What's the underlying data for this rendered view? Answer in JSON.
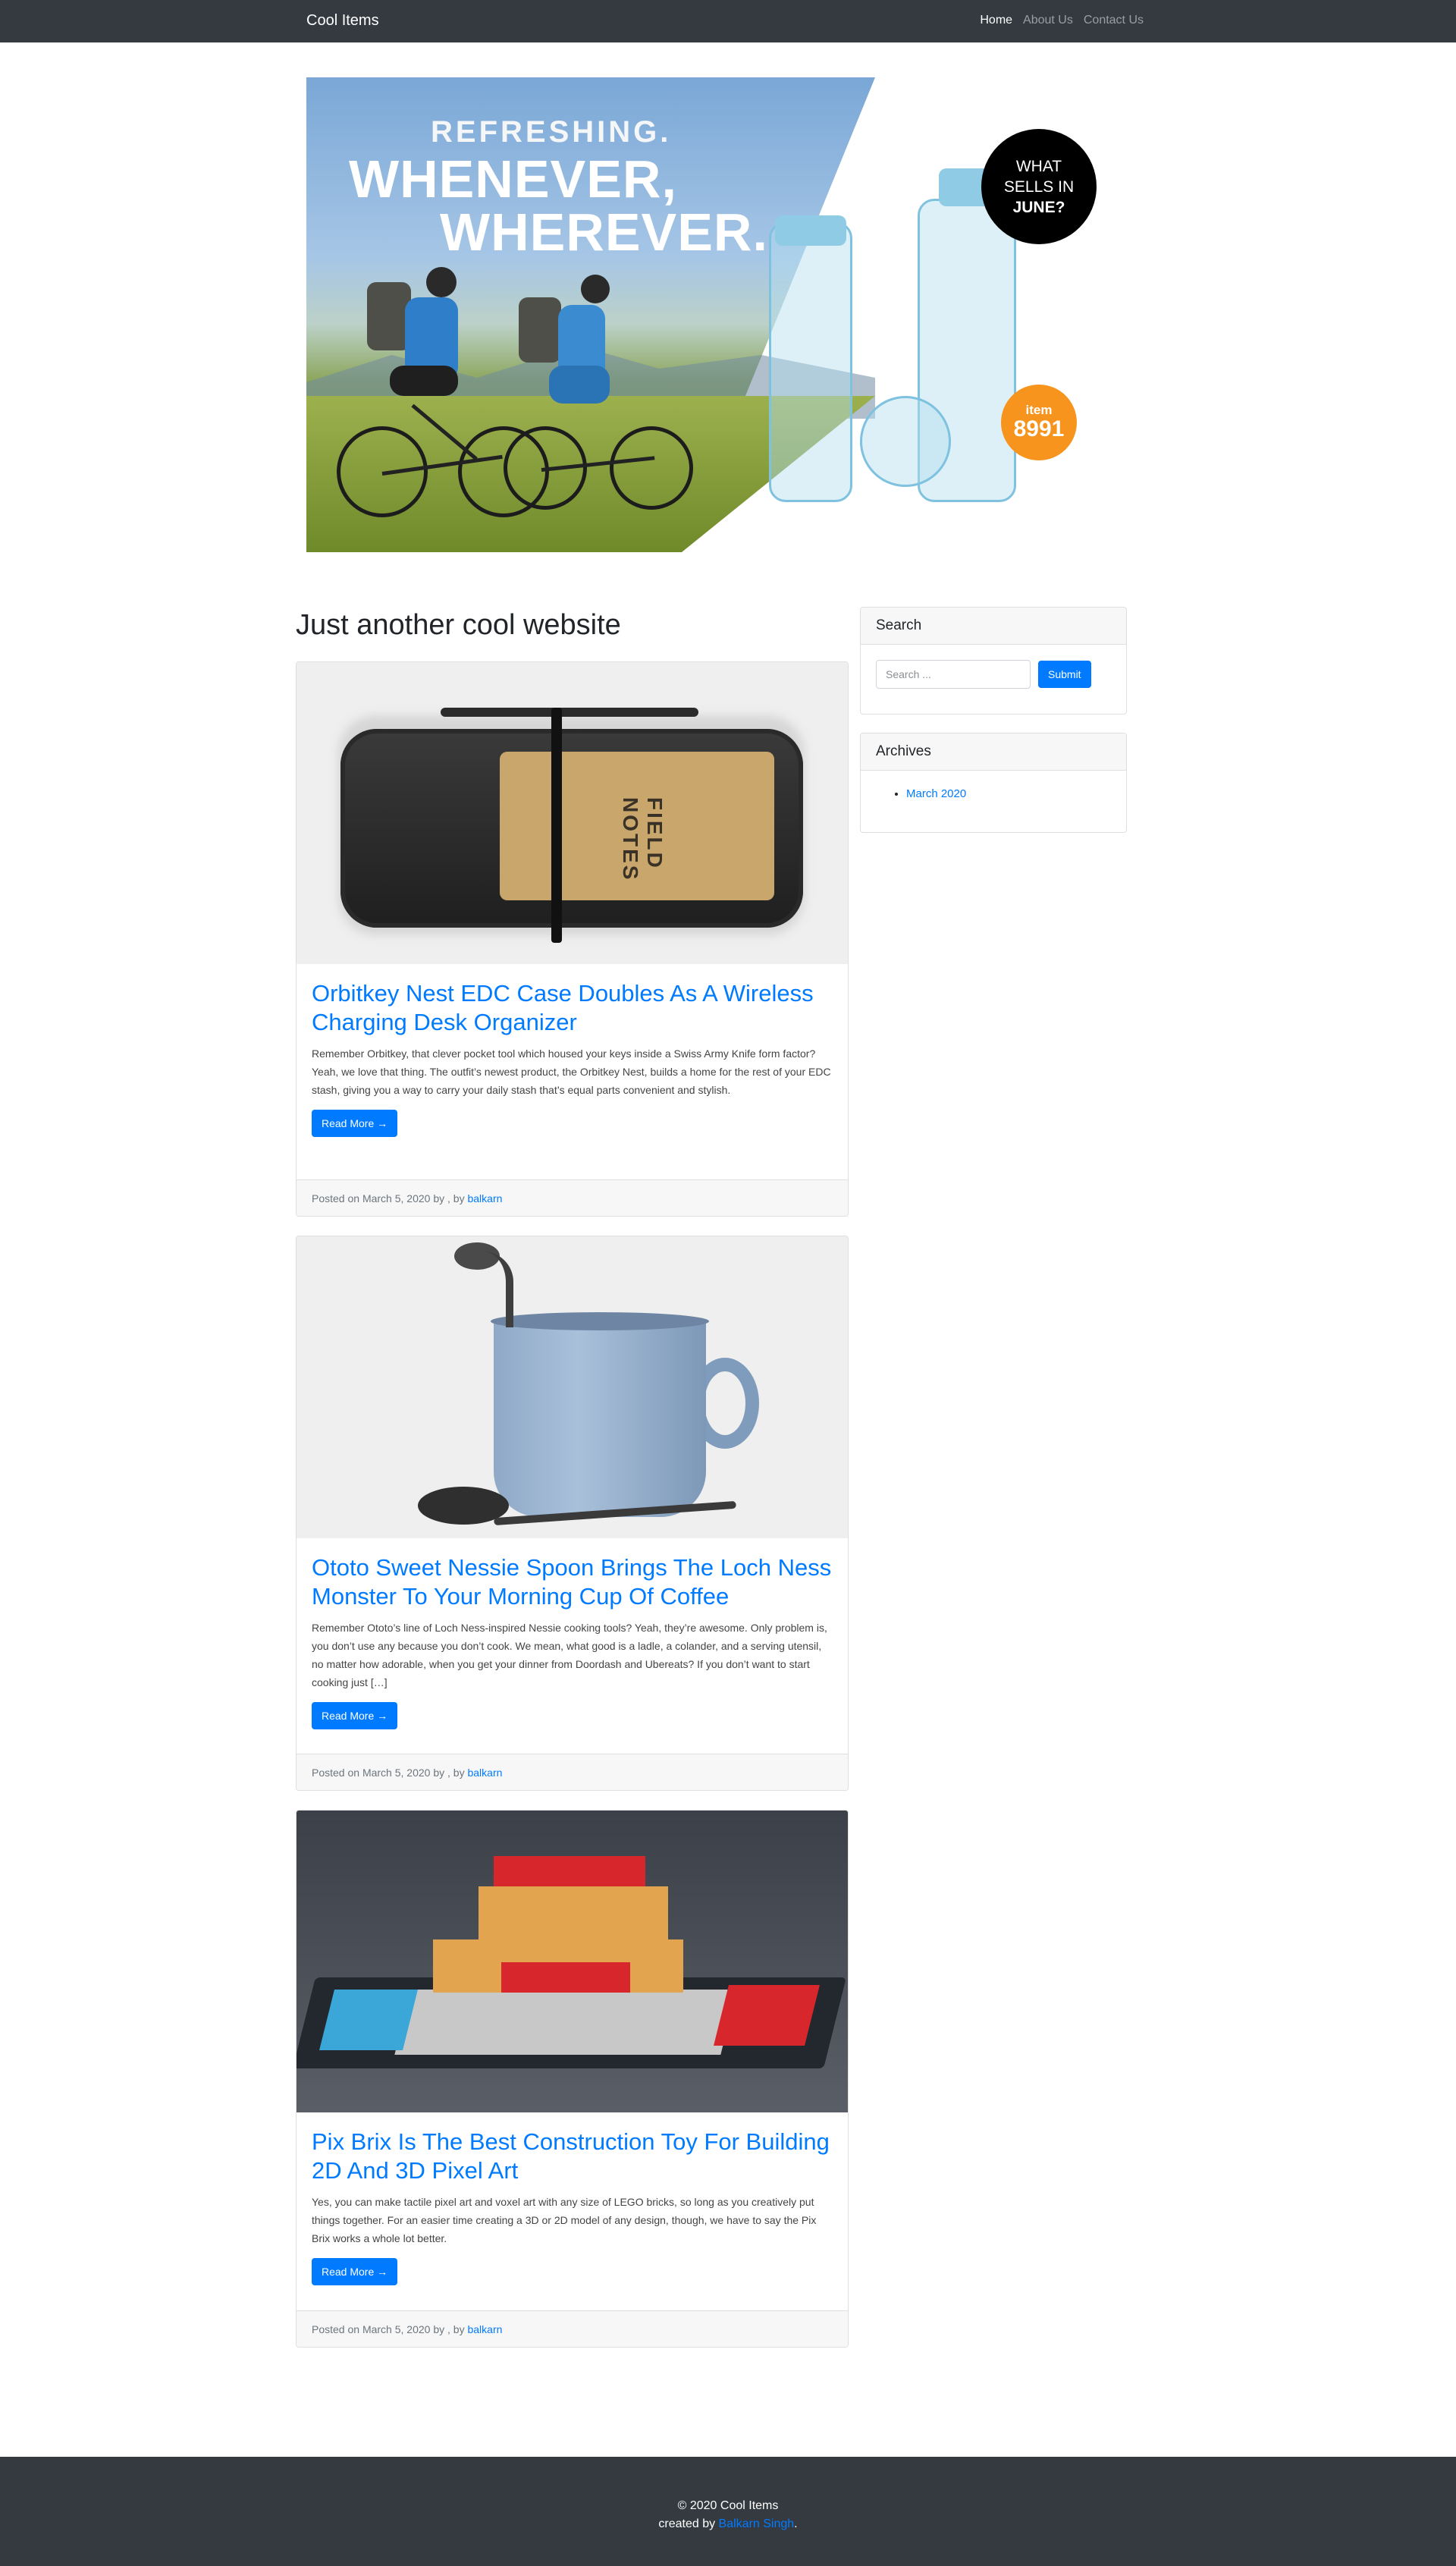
{
  "navbar": {
    "brand": "Cool Items",
    "links": [
      {
        "label": "Home",
        "active": true
      },
      {
        "label": "About Us",
        "active": false
      },
      {
        "label": "Contact Us",
        "active": false
      }
    ]
  },
  "hero": {
    "line1": "REFRESHING.",
    "line2": "WHENEVER,",
    "line3": "WHEREVER.",
    "badge_what": "WHAT",
    "badge_sells": "SELLS IN",
    "badge_june": "JUNE?",
    "badge_item": "item",
    "badge_item_number": "8991",
    "colors": {
      "badge_dark": "#000000",
      "badge_orange": "#f7941d",
      "bottle": "#7fc2df"
    }
  },
  "main": {
    "site_title": "Just another cool website",
    "posts": [
      {
        "title": "Orbitkey Nest EDC Case Doubles As A Wireless Charging Desk Organizer",
        "excerpt": "Remember Orbitkey, that clever pocket tool which housed your keys inside a Swiss Army Knife form factor? Yeah, we love that thing. The outfit’s newest product, the Orbitkey Nest, builds a home for the rest of your EDC stash, giving you a way to carry your daily stash that’s equal parts convenient and stylish.",
        "button": "Read More →",
        "posted": "Posted on March 5, 2020 by , by",
        "author": "balkarn",
        "image_icon": "edc-case-image",
        "notebook_brand": "FIELD NOTES"
      },
      {
        "title": "Ototo Sweet Nessie Spoon Brings The Loch Ness Monster To Your Morning Cup Of Coffee",
        "excerpt": "Remember Ototo’s line of Loch Ness-inspired Nessie cooking tools? Yeah, they’re awesome. Only problem is, you don’t use any because you don’t cook. We mean, what good is a ladle, a colander, and a serving utensil, no matter how adorable, when you get your dinner from Doordash and Ubereats? If you don’t want to start cooking just […]",
        "button": "Read More →",
        "posted": "Posted on March 5, 2020 by , by",
        "author": "balkarn",
        "image_icon": "mug-spoon-image"
      },
      {
        "title": "Pix Brix Is The Best Construction Toy For Building 2D And 3D Pixel Art",
        "excerpt": "Yes, you can make tactile pixel art and voxel art with any size of LEGO bricks, so long as you creatively put things together. For an easier time creating a 3D or 2D model of any design, though, we have to say the Pix Brix works a whole lot better.",
        "button": "Read More →",
        "posted": "Posted on March 5, 2020 by , by",
        "author": "balkarn",
        "image_icon": "pixel-art-image"
      }
    ]
  },
  "sidebar": {
    "search": {
      "title": "Search",
      "placeholder": "Search ...",
      "button": "Submit"
    },
    "archives": {
      "title": "Archives",
      "items": [
        "March 2020"
      ]
    }
  },
  "footer": {
    "copyright": "© 2020 Cool Items",
    "created_by": "created by",
    "creator": "Balkarn Singh",
    "period": "."
  },
  "colors": {
    "accent": "#007bff",
    "navbar": "#343a40"
  }
}
